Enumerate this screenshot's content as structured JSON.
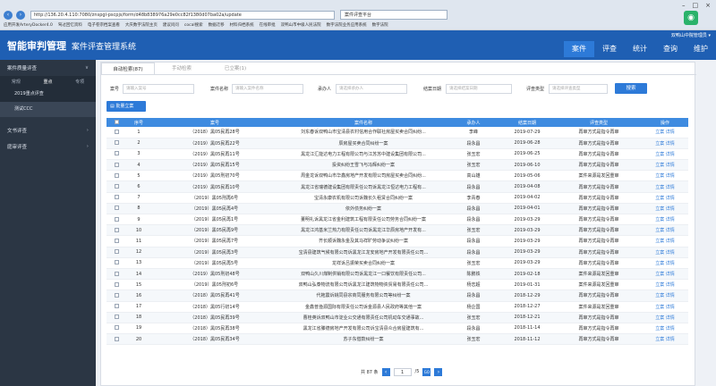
{
  "browser": {
    "url": "http://136.20.4.110:7080/znspgl-pscpjs/form/d48b838976a29e0cc82f1380d07ba02a/update",
    "tab_title": "案件评查平台",
    "bookmarks": [
      "应用开发ArteryDocker4.0",
      "驾过回忆资料",
      "电子卷宗档案查看",
      "大庆数字法院主页",
      "建议问问",
      "cocal搜索",
      "数据迁移",
      "材料归档系统",
      "在线审批",
      "双鸭山市中级人民法院",
      "数字法院业务应用系统",
      "数字法院"
    ]
  },
  "header": {
    "logo": "智能审判管理",
    "system_name": "案件评查管理系统",
    "user": "双鸭山中院管理员 ▾",
    "nav": [
      "案件",
      "评查",
      "统计",
      "markdown-free:查询",
      "维护"
    ],
    "active_nav": 0
  },
  "sidebar": {
    "items": [
      {
        "label": "案件质量评查",
        "arrow": "∨"
      },
      {
        "label": "文书评查",
        "arrow": "›"
      },
      {
        "label": "庭审评查",
        "arrow": "›"
      }
    ],
    "tabs": [
      "常规",
      "重点",
      "专项"
    ],
    "sub_items": [
      "2019重点评查",
      "测试CCC"
    ]
  },
  "content": {
    "tabs": [
      "自动检索(87)",
      "手动检索",
      "已立案(1)"
    ],
    "filters": {
      "case_no_label": "案号",
      "case_no_placeholder": "请输入案号",
      "case_name_label": "案件名称",
      "case_name_placeholder": "请输入案件名称",
      "judge_label": "承办人",
      "judge_placeholder": "请选择承办人",
      "date_label": "结案日期",
      "date_placeholder": "请选择结案日期",
      "type_label": "评查类型",
      "type_placeholder": "请选择评查类型",
      "search_btn": "搜索"
    },
    "batch_btn": "批量立案",
    "columns": [
      "",
      "序号",
      "案号",
      "案件名称",
      "承办人",
      "结案日期",
      "评查类型",
      "操作"
    ],
    "rows": [
      [
        "1",
        "（2018）黑05民再28号",
        "刘东春诉双鸭山市宝清县农村信用合作联社房屋买卖合同纠纷...",
        "李峰",
        "2019-07-29",
        "再审方式是指令再审"
      ],
      [
        "2",
        "（2019）黑05民再22号",
        "辰房屋买卖合同纠纷一案",
        "段永昌",
        "2019-06-28",
        "再审方式是指令再审"
      ],
      [
        "3",
        "（2019）黑05民再11号",
        "黑龙江汇能达电力工程有限公司与江苏苏中建设集团有限公司...",
        "张玉宏",
        "2019-06-25",
        "再审方式是指令再审"
      ],
      [
        "4",
        "（2019）黑05民再15号",
        "投资纠纷王雪飞与冯辉纠纷一案",
        "张玉宏",
        "2019-06-10",
        "再审方式是指令再审"
      ],
      [
        "5",
        "（2019）黑05刑初70号",
        "周金龙诉双鸭山市华鑫房地产开发有限公司房屋买卖合同纠纷...",
        "高山雄",
        "2019-05-06",
        "案件来源是发回重审"
      ],
      [
        "6",
        "（2019）黑05民再10号",
        "黑龙江省瑞德建设集团有限责任公司诉黑龙江恒达电力工程有...",
        "段永昌",
        "2019-04-08",
        "再审方式是指令再审"
      ],
      [
        "7",
        "（2019）黑05刑再6号",
        "宝清永康农机有限公司诉魏长久租赁合同纠纷一案",
        "李青春",
        "2019-04-02",
        "再审方式是指令再审"
      ],
      [
        "8",
        "（2019）黑05民再4号",
        "依外债务纠纷一案",
        "段永昌",
        "2019-04-01",
        "再审方式是指令再审"
      ],
      [
        "9",
        "（2019）黑05民再1号",
        "董明礼诉黑龙江省金利建筑工程有限责任公司劳务合同纠纷一案",
        "段永昌",
        "2019-03-29",
        "再审方式是指令再审"
      ],
      [
        "10",
        "（2019）黑05民再9号",
        "黑龙江鸿基米兰热力有限责任公司诉黑龙江华辰房地产开发有...",
        "张玉宏",
        "2019-03-29",
        "再审方式是指令再审"
      ],
      [
        "11",
        "（2019）黑05民再7号",
        "齐长顺诉魏永金及其马祥旷劳动争议纠纷一案",
        "段永昌",
        "2019-03-29",
        "再审方式是指令再审"
      ],
      [
        "12",
        "（2019）黑05民再3号",
        "宝清县建筑气候有限公司诉黑龙江龙安房地产开发有限责任公司...",
        "段永昌",
        "2019-03-29",
        "再审方式是指令再审"
      ],
      [
        "13",
        "（2019）黑05民再5号",
        "龙祥诉吕振荣买卖合同纠纷一案",
        "张玉宏",
        "2019-03-29",
        "再审方式是指令再审"
      ],
      [
        "14",
        "（2019）黑05刑初48号",
        "双鸭山久川煤制供销有限公司诉黑龙江一口餐饮有限责任公司...",
        "陈鹏铁",
        "2019-02-18",
        "案件来源是发回重审"
      ],
      [
        "15",
        "（2019）黑05刑初6号",
        "双鸭山弘泰物流有限公司诉黑龙江建筑物物资贸易有限责任公司...",
        "杨志超",
        "2019-01-31",
        "案件来源是发回重审"
      ],
      [
        "16",
        "（2018）黑05民再41号",
        "代拖震诉姚同县宗商同服务有限公司等纠纷一案",
        "段永昌",
        "2018-12-29",
        "再审方式是指令再审"
      ],
      [
        "17",
        "（2018）黑05行初14号",
        "金鑫普渔源国际有限责任公司诉金源县人民政府等其他一案",
        "杨企国",
        "2018-12-27",
        "案件来源是发回重审"
      ],
      [
        "18",
        "（2018）黑05民再39号",
        "曹桂英诉双鸭山市淀业公交通有限责任公司机动车交通事故...",
        "张玉宏",
        "2018-12-21",
        "再审方式是指令再审"
      ],
      [
        "19",
        "（2018）黑05民再38号",
        "黑龙江省滕德房地产开发有限公司诉宝清县众合房屋建筑有...",
        "段永昌",
        "2018-11-14",
        "再审方式是指令再审"
      ],
      [
        "20",
        "（2018）黑05民再34号",
        "苏子东借款纠纷一案",
        "张玉宏",
        "2018-11-12",
        "再审方式是指令再审"
      ]
    ],
    "op_file": "立案",
    "op_detail": "详情",
    "pager": {
      "total": "共 87 条",
      "page": "1",
      "pages": "/5",
      "go": "GO"
    }
  },
  "colors": {
    "header_blue": "#1f5fb3",
    "accent": "#2d7ad8",
    "sidebar": "#2b3644",
    "table_head": "#3e8be0"
  }
}
